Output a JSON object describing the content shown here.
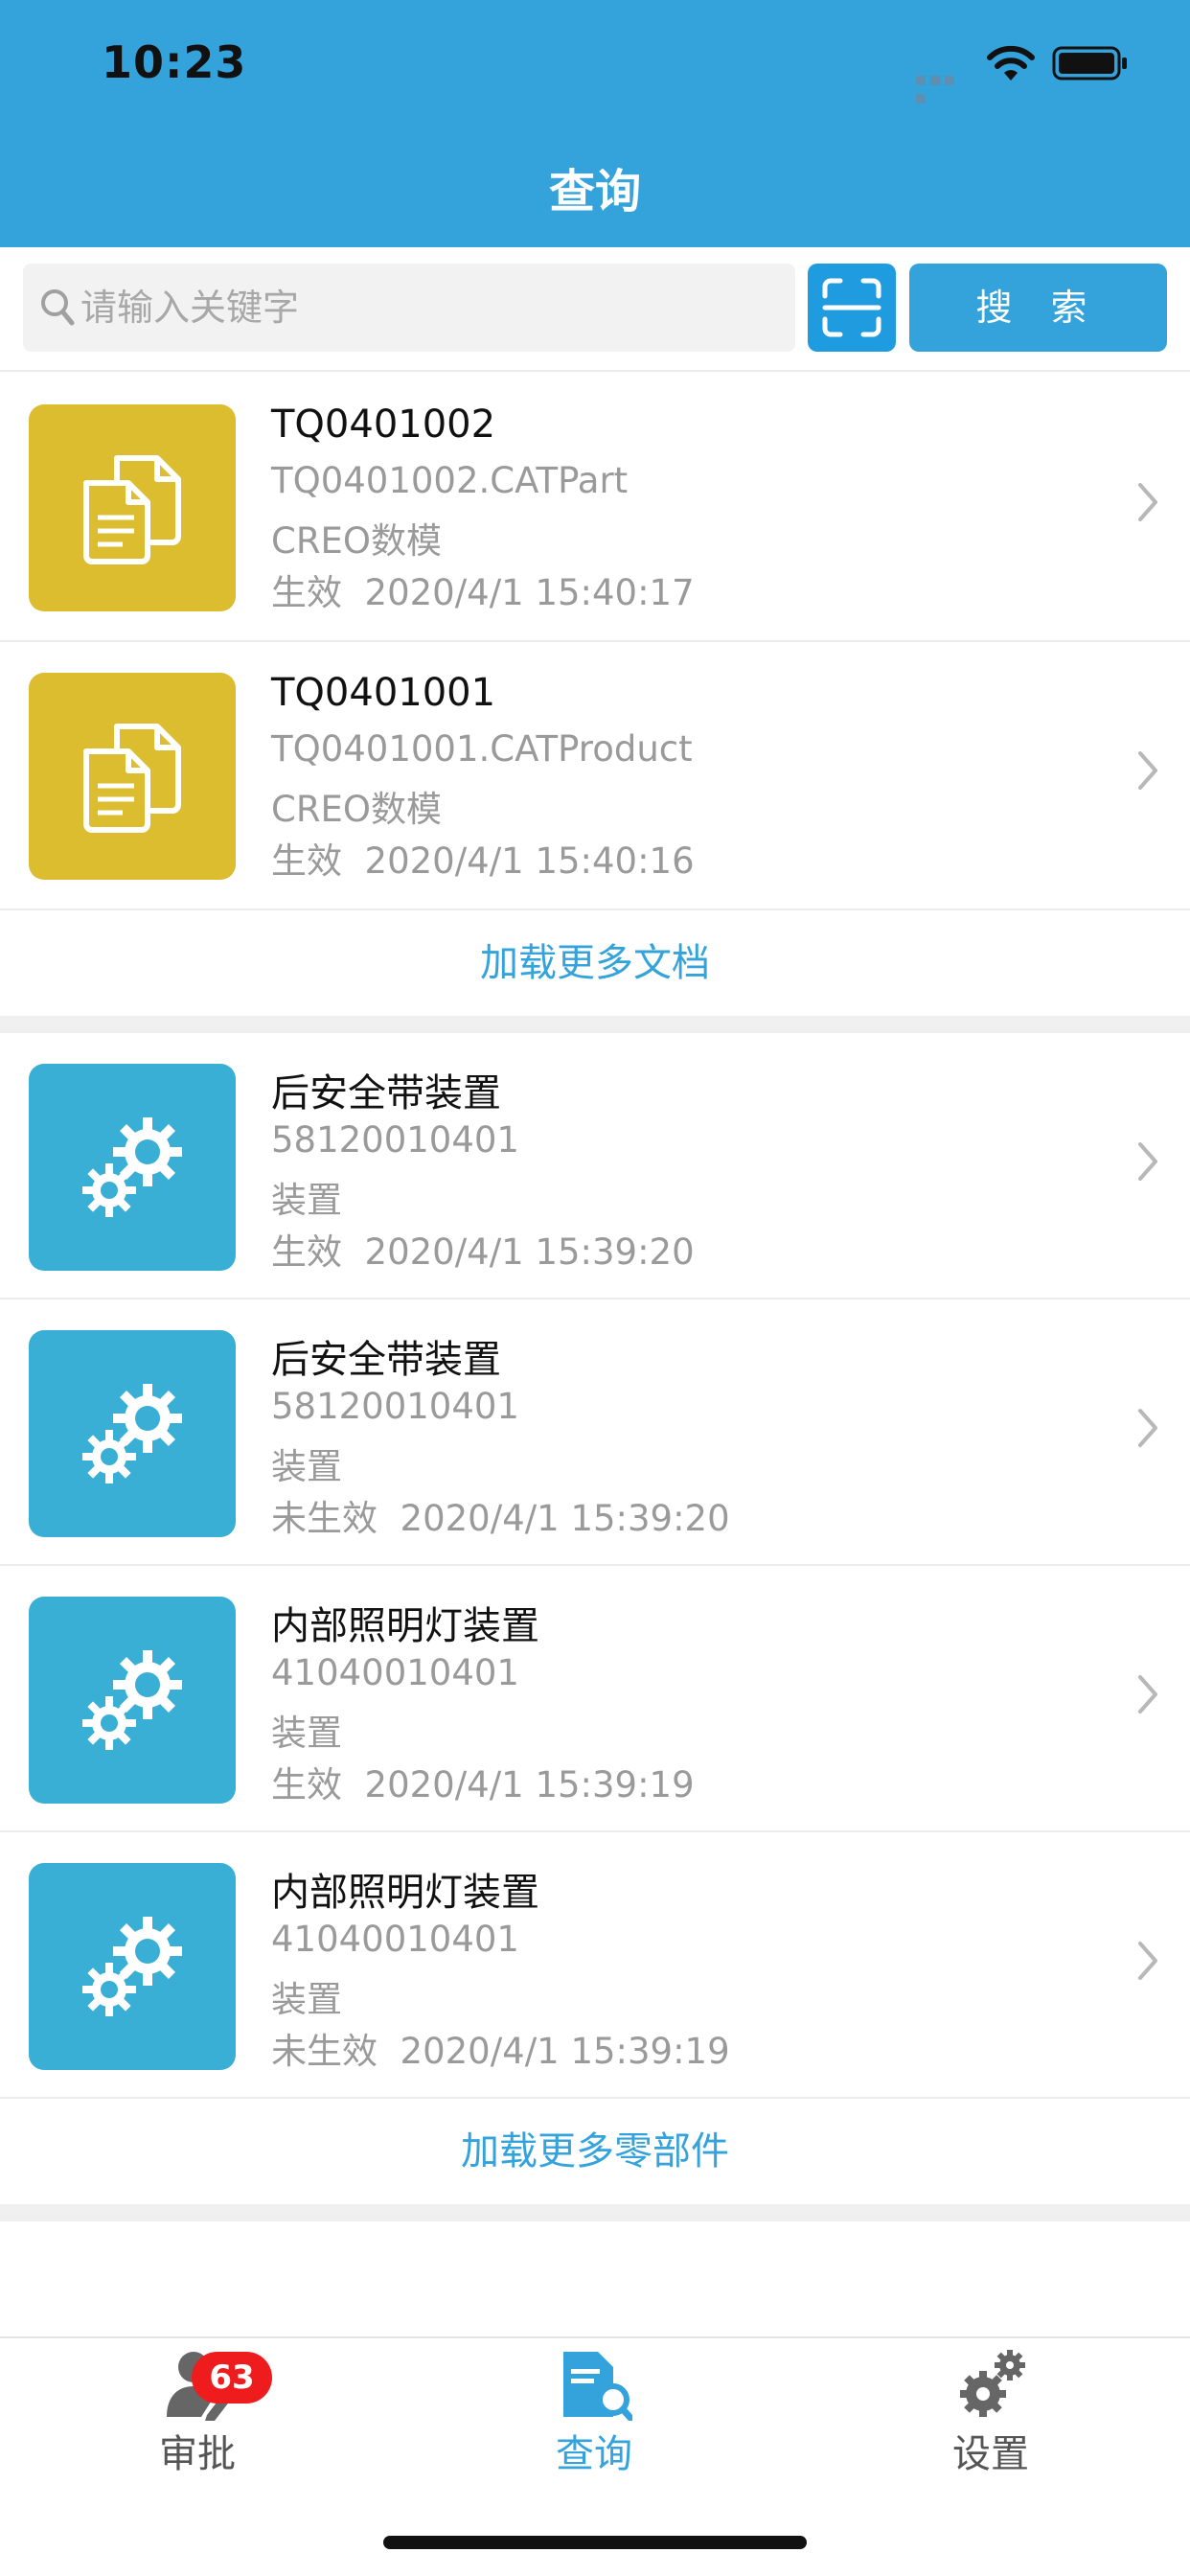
{
  "status_bar": {
    "time": "10:23"
  },
  "header": {
    "title": "查询"
  },
  "search": {
    "placeholder": "请输入关键字",
    "value": "",
    "button_label": "搜 索"
  },
  "documents": [
    {
      "title": "TQ0401002",
      "filename": "TQ0401002.CATPart",
      "type": "CREO数模",
      "status": "生效",
      "date": "2020/4/1 15:40:17"
    },
    {
      "title": "TQ0401001",
      "filename": "TQ0401001.CATProduct",
      "type": "CREO数模",
      "status": "生效",
      "date": "2020/4/1 15:40:16"
    }
  ],
  "load_more_documents": "加载更多文档",
  "parts": [
    {
      "title": "后安全带装置",
      "number": "58120010401",
      "type": "装置",
      "status": "生效",
      "date": "2020/4/1 15:39:20"
    },
    {
      "title": "后安全带装置",
      "number": "58120010401",
      "type": "装置",
      "status": "未生效",
      "date": "2020/4/1 15:39:20"
    },
    {
      "title": "内部照明灯装置",
      "number": "41040010401",
      "type": "装置",
      "status": "生效",
      "date": "2020/4/1 15:39:19"
    },
    {
      "title": "内部照明灯装置",
      "number": "41040010401",
      "type": "装置",
      "status": "未生效",
      "date": "2020/4/1 15:39:19"
    }
  ],
  "load_more_parts": "加载更多零部件",
  "tabbar": {
    "approve": {
      "label": "审批",
      "badge": "63",
      "icon": "person-edit-icon"
    },
    "query": {
      "label": "查询",
      "icon": "document-search-icon"
    },
    "settings": {
      "label": "设置",
      "icon": "gears-icon"
    }
  },
  "colors": {
    "header": "#35a3db",
    "accent": "#35a3db",
    "doc_thumb": "#dbbd2f",
    "part_thumb": "#39afd6",
    "badge": "#ee1c1c"
  }
}
